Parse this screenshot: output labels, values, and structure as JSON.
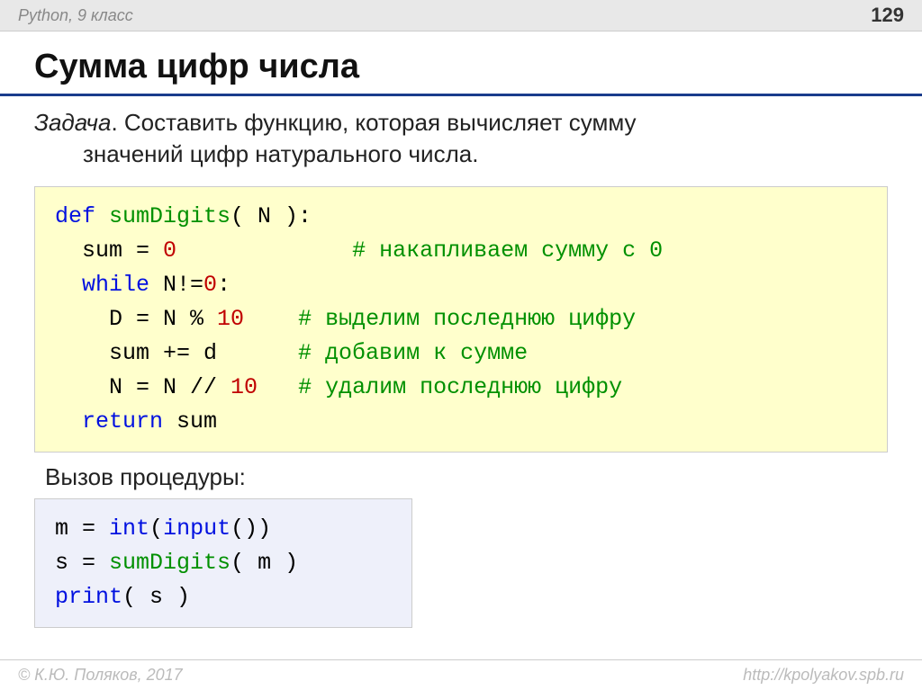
{
  "header": {
    "left": "Python, 9 класс",
    "page": "129"
  },
  "title": "Сумма цифр числа",
  "task": {
    "label": "Задача",
    "line1": ". Составить функцию, которая вычисляет сумму",
    "line2": "значений цифр натурального числа."
  },
  "code1": {
    "l1_def": "def",
    "l1_fn": " sumDigits",
    "l1_rest": "( N ):",
    "l2_a": "  sum",
    "l2_eq": " = ",
    "l2_zero": "0",
    "l2_pad": "             ",
    "l2_cmt": "# накапливаем сумму с 0",
    "l3_while": "  while",
    "l3_rest": " N!=",
    "l3_zero": "0",
    "l3_colon": ":",
    "l4_a": "    D",
    "l4_eq": " = ",
    "l4_b": "N % ",
    "l4_ten": "10",
    "l4_pad": "    ",
    "l4_cmt": "# выделим последнюю цифру",
    "l5_a": "    sum += d      ",
    "l5_cmt": "# добавим к сумме",
    "l6_a": "    N",
    "l6_eq": " = ",
    "l6_b": "N // ",
    "l6_ten": "10",
    "l6_pad": "   ",
    "l6_cmt": "# удалим последнюю цифру",
    "l7_ret": "  return",
    "l7_rest": " sum"
  },
  "subheading": "Вызов процедуры:",
  "code2": {
    "l1_a": "m",
    "l1_eq": " = ",
    "l1_int": "int",
    "l1_p1": "(",
    "l1_input": "input",
    "l1_p2": "())",
    "l2_a": "s",
    "l2_eq": " = ",
    "l2_fn": "sumDigits",
    "l2_rest": "( m )",
    "l3_print": "print",
    "l3_rest": "( s )"
  },
  "footer": {
    "left": "© К.Ю. Поляков, 2017",
    "right": "http://kpolyakov.spb.ru"
  }
}
